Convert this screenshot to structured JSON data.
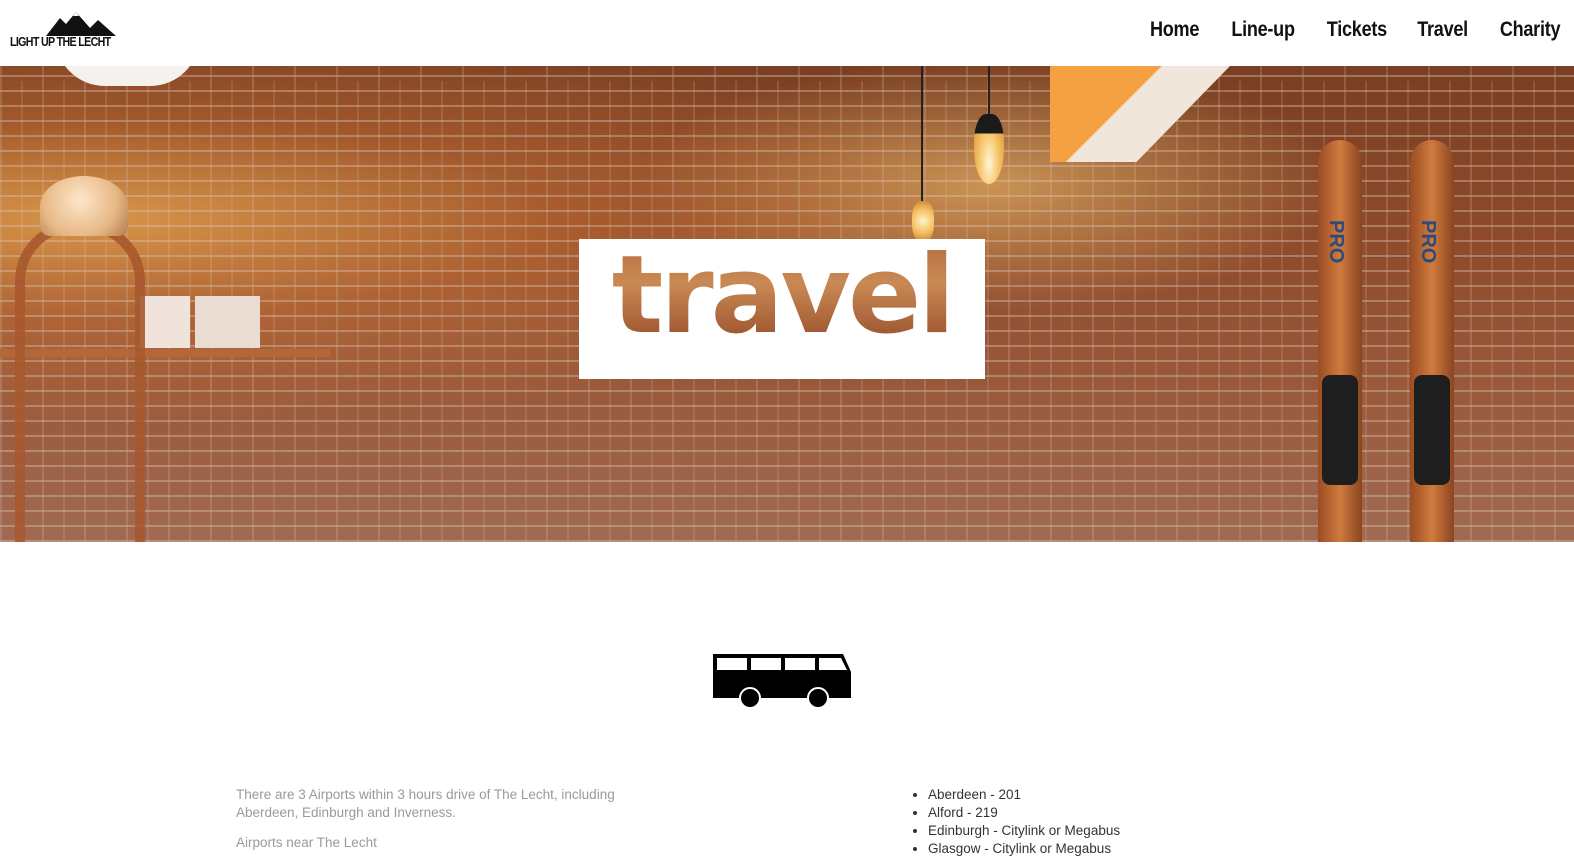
{
  "header": {
    "logo_text": "LIGHT UP THE LECHT",
    "nav": [
      "Home",
      "Line-up",
      "Tickets",
      "Travel",
      "Charity"
    ]
  },
  "hero": {
    "title": "travel",
    "ski_text": "PRO"
  },
  "content": {
    "icon": "bus-icon",
    "left_paragraphs": [
      "There are 3 Airports within 3 hours drive of The Lecht, including Aberdeen, Edinburgh and Inverness.",
      "Airports near The Lecht"
    ],
    "right_list": [
      "Aberdeen - 201",
      "Alford - 219",
      "Edinburgh - Citylink or Megabus",
      "Glasgow - Citylink or Megabus"
    ]
  },
  "colors": {
    "text_dark": "#111111",
    "text_muted": "#9a9a9a",
    "background": "#ffffff",
    "brick": "#8d4a2a"
  }
}
